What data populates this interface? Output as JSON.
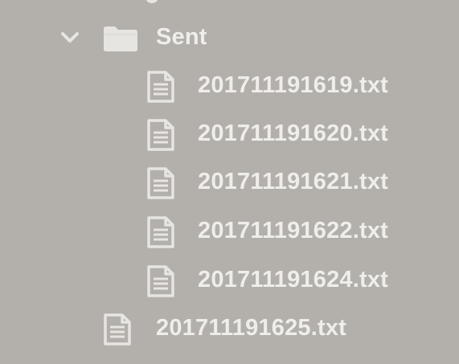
{
  "colors": {
    "background": "#b3b0ab",
    "text": "#efeeeb",
    "icon": "#e7e5e1"
  },
  "folder": {
    "name": "Sent",
    "expanded": true,
    "icon": "folder-icon",
    "toggle_icon": "chevron-down-icon"
  },
  "folder_files": [
    {
      "name": "201711191619.txt",
      "icon": "text-file-icon"
    },
    {
      "name": "201711191620.txt",
      "icon": "text-file-icon"
    },
    {
      "name": "201711191621.txt",
      "icon": "text-file-icon"
    },
    {
      "name": "201711191622.txt",
      "icon": "text-file-icon"
    },
    {
      "name": "201711191624.txt",
      "icon": "text-file-icon"
    }
  ],
  "root_files": [
    {
      "name": "201711191625.txt",
      "icon": "text-file-icon"
    }
  ]
}
